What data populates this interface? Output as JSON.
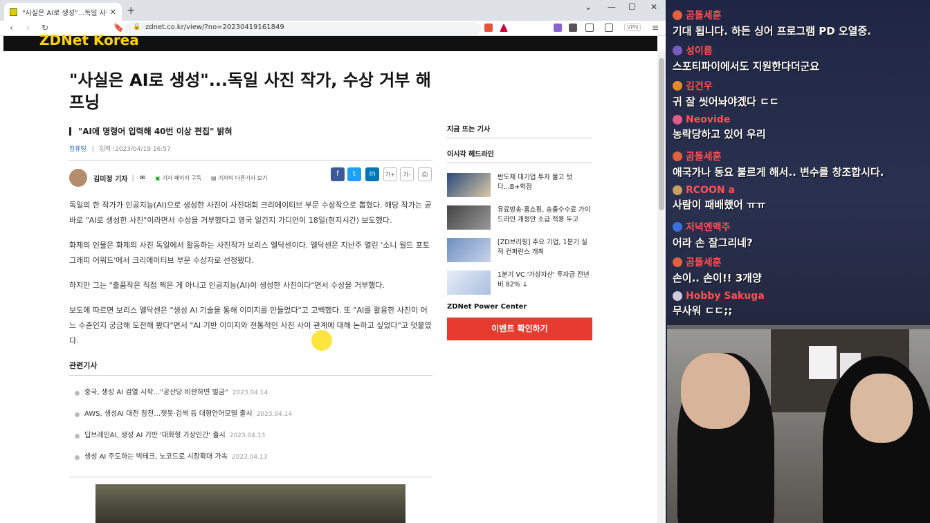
{
  "browser": {
    "tab_title": "\"사실은 AI로 생성\"...독일 사진 작",
    "url": "zdnet.co.kr/view/?no=20230419161849",
    "vpn": "VPN",
    "site_logo": "ZDNet Korea"
  },
  "article": {
    "headline": "\"사실은 AI로 생성\"...독일 사진 작가, 수상 거부 해프닝",
    "subhead": "\"AI에 명령어 입력해 40번 이상 편집\" 밝혀",
    "category": "컴퓨팅",
    "date": "입력 :2023/04/19 16:57",
    "author": "김미정 기자",
    "subscribe": "기자 페이지 구독",
    "other_articles": "기자의 다른기사 보기",
    "font_up": "가+",
    "font_down": "가-",
    "paragraphs": [
      "독일의 한 작가가 인공지능(AI)으로 생성한 사진이 사진대회 크리에이티브 부문 수상작으로 뽑혔다. 해당 작가는 곧바로 \"AI로 생성한 사진\"이라면서 수상을 거부했다고 영국 일간지 가디언이 18일(현지시간) 보도했다.",
      "화제의 인물은 화제의 사진 독일에서 활동하는 사진작가 보리스 엘닥센이다. 엘닥센은 지난주 열린 '소니 월드 포토그래피 어워드'에서 크리에이티브 부문 수상자로 선정됐다.",
      "하지만 그는 \"출품작은 직접 찍은 게 아니고 인공지능(AI)이 생성한 사진이다\"면서 수상을 거부했다.",
      "보도에 따르면 보리스 엘닥센은 \"생성 AI 기술을 통해 이미지를 만들었다\"고 고백했다. 또 \"AI를 활용한 사진이 어느 수준인지 궁금해 도전해 봤다\"면서 \"AI 기반 이미지와 전통적인 사진 사이 관계에 대해 논하고 싶었다\"고 덧붙였다."
    ],
    "related_title": "관련기사",
    "related": [
      {
        "title": "중국, 생성 AI 검열 시작…\"공산당 비판하면 벌금\"",
        "date": "2023.04.14"
      },
      {
        "title": "AWS, 생성AI 대전 참전…챗봇·검색 등 대형언어모델 출시",
        "date": "2023.04.14"
      },
      {
        "title": "딥브레인AI, 생성 AI 기반 '대화형 가상인간' 출시",
        "date": "2023.04.13"
      },
      {
        "title": "생성 AI 주도하는 빅테크, 노코드로 시장확대 가속",
        "date": "2023.04.13"
      }
    ]
  },
  "sidebar": {
    "trending": "지금 뜨는 기사",
    "headlines": "이시각 헤드라인",
    "news": [
      {
        "text": "반도체 대기업 투자 물고 텃다...B+학점"
      },
      {
        "text": "유료방송·홈쇼핑, 송출수수료 가이드라인 개정안 소급 적용 두고"
      },
      {
        "text": "[ZD브리핑] 주요 기업, 1분기 실적 컨퍼런스 개최"
      },
      {
        "text": "1분기 VC '가상자산' 투자금 전년비 82% ↓"
      }
    ],
    "power_center": "ZDNet Power Center",
    "event_button": "이벤트 확인하기"
  },
  "chat": [
    {
      "user": "곰돌세훈",
      "text": "기대 됩니다. 하든 싱어 프로그램 PD 오열중.",
      "color": "#ff5050"
    },
    {
      "user": "성이름",
      "text": "스포티파이에서도 지원한다더군요",
      "color": "#ff5050"
    },
    {
      "user": "김건우",
      "text": "귀 잘 씻어놔야겠다 ㄷㄷ",
      "color": "#ff5050"
    },
    {
      "user": "Neovide",
      "text": "농락당하고 있어 우리",
      "color": "#ff5050"
    },
    {
      "user": "곰돌세훈",
      "text": "애국가나 동요 불르게 해서.. 변수를 창조합시다.",
      "color": "#ff5050"
    },
    {
      "user": "RCOON a",
      "text": "사람이 패배했어 ㅠㅠ",
      "color": "#ff5050"
    },
    {
      "user": "저녁엔맥주",
      "text": "어라 손 잘그리네?",
      "color": "#ff5050"
    },
    {
      "user": "곰돌세훈",
      "text": "손이.. 손이!! 3개양",
      "color": "#ff5050"
    },
    {
      "user": "Hobby Sakuga",
      "text": "무사워 ㄷㄷ;;",
      "color": "#ff5050"
    }
  ]
}
